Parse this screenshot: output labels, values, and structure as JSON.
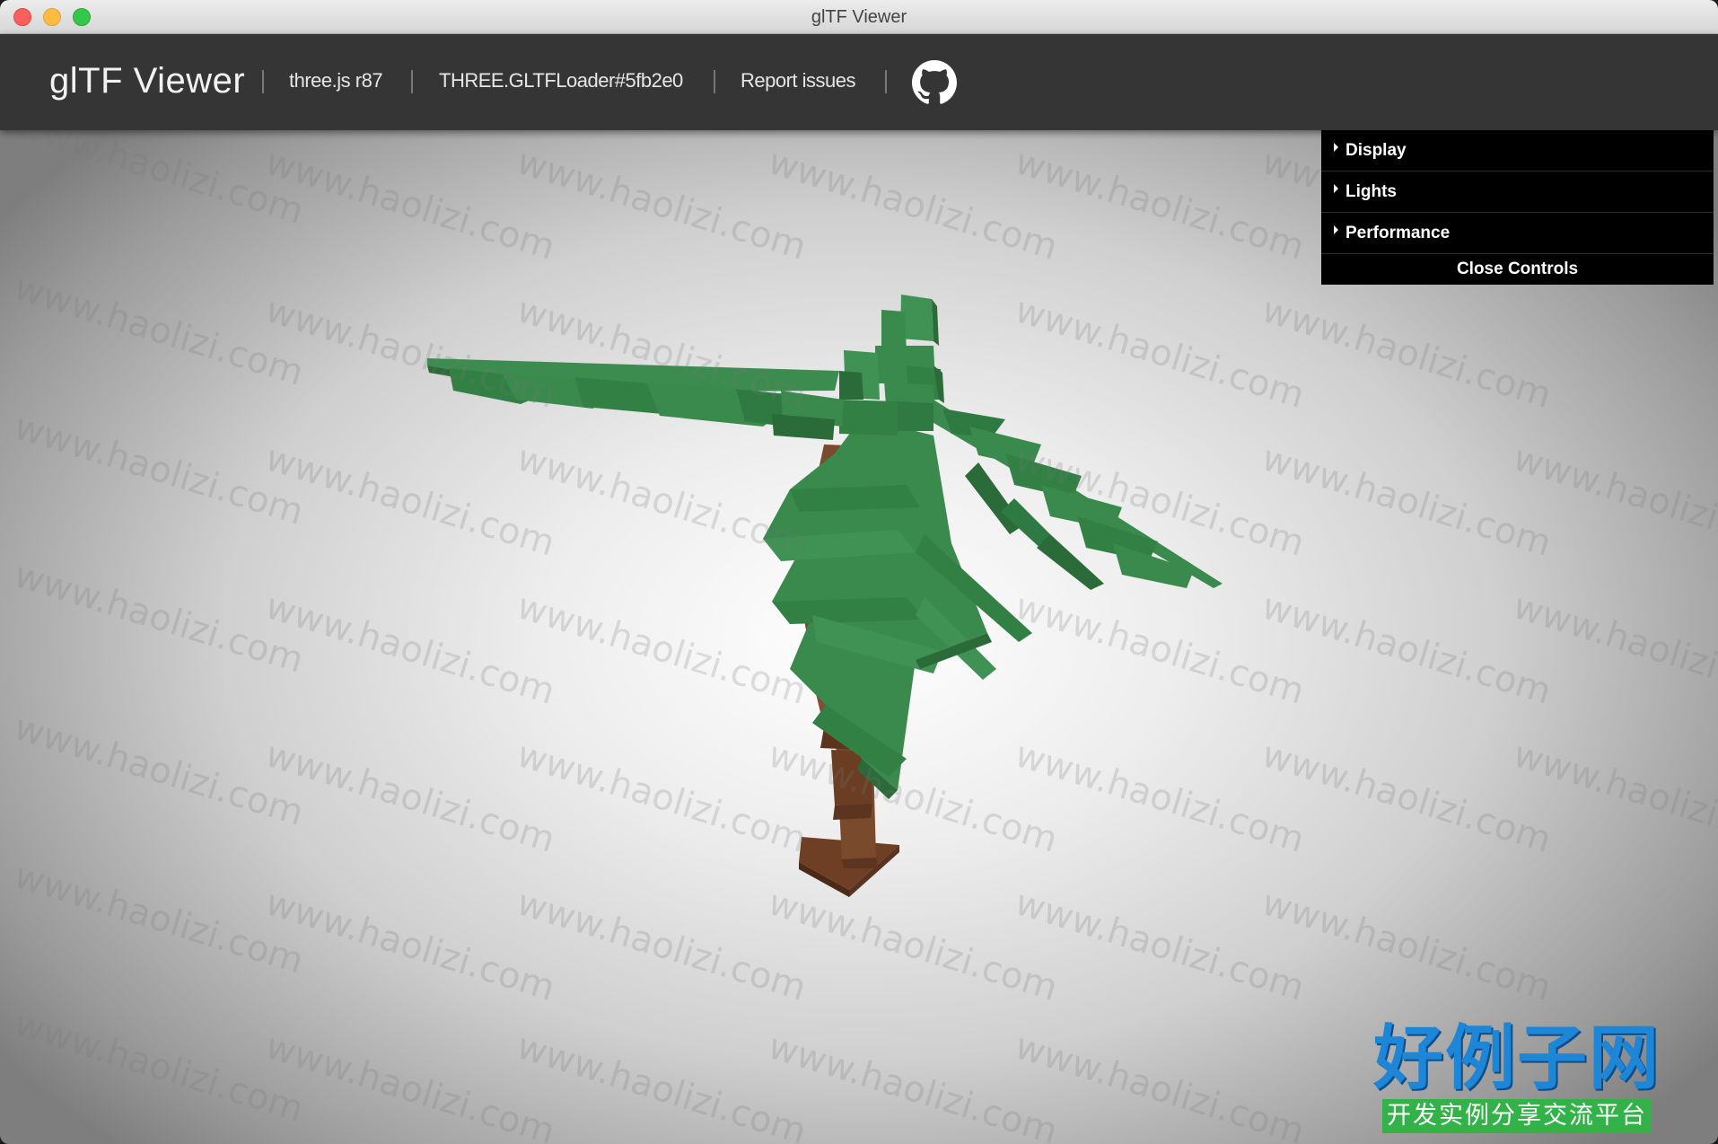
{
  "window": {
    "title": "glTF Viewer"
  },
  "header": {
    "brand": "glTF Viewer",
    "links": [
      {
        "label": "three.js r87"
      },
      {
        "label": "THREE.GLTFLoader#5fb2e0"
      },
      {
        "label": "Report issues"
      }
    ],
    "github_icon": "github-icon"
  },
  "gui": {
    "folders": [
      {
        "label": "Display"
      },
      {
        "label": "Lights"
      },
      {
        "label": "Performance"
      }
    ],
    "close_label": "Close Controls"
  },
  "watermark": {
    "text": "www.haolizi.com"
  },
  "corner_logo": {
    "title": "好例子网",
    "subtitle": "开发实例分享交流平台"
  },
  "colors": {
    "header_bg": "#353535",
    "leaf": "#3a8a4e",
    "leaf_dark": "#2a6b39",
    "trunk": "#7a4a2d",
    "trunk_dark": "#5c3520",
    "logo_blue": "#1e86d6",
    "logo_green": "#33b24a"
  }
}
